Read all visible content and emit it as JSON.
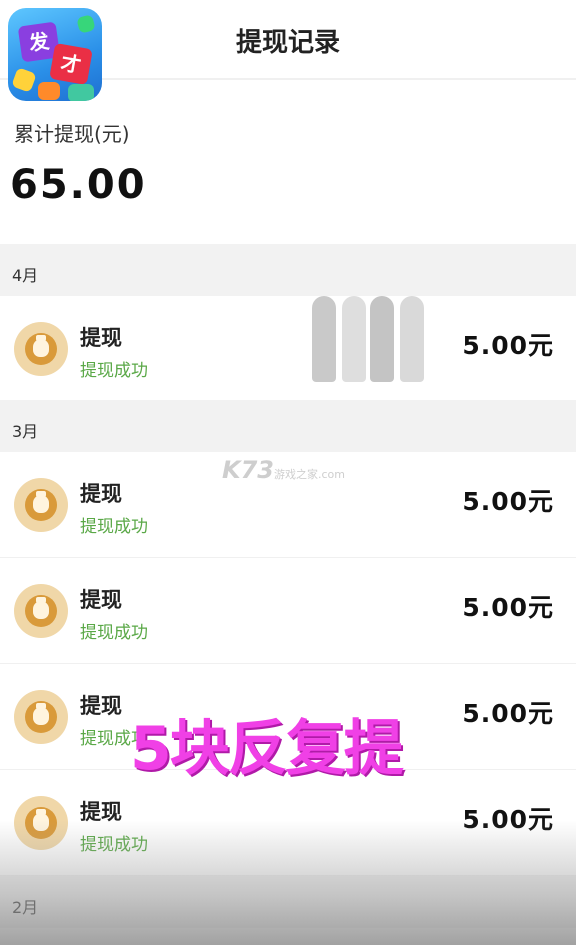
{
  "header": {
    "title": "提现记录",
    "logo": {
      "chars": [
        "发",
        "才"
      ]
    }
  },
  "summary": {
    "label": "累计提现(元)",
    "amount": "65.00"
  },
  "sections": [
    {
      "month": "4月",
      "records": [
        {
          "title": "提现",
          "status": "提现成功",
          "amount": "5.00元"
        }
      ]
    },
    {
      "month": "3月",
      "records": [
        {
          "title": "提现",
          "status": "提现成功",
          "amount": "5.00元"
        },
        {
          "title": "提现",
          "status": "提现成功",
          "amount": "5.00元"
        },
        {
          "title": "提现",
          "status": "提现成功",
          "amount": "5.00元"
        },
        {
          "title": "提现",
          "status": "提现成功",
          "amount": "5.00元"
        }
      ]
    },
    {
      "month": "2月",
      "records": []
    }
  ],
  "overlay": {
    "watermark_main": "K73",
    "watermark_sub": "游戏之家",
    "watermark_domain": ".com",
    "caption": "5块反复提"
  },
  "colors": {
    "status_green": "#5aa847",
    "coin_gold": "#d99a3a",
    "caption_magenta": "#f040e6"
  },
  "icons": {
    "record": "money-bag-icon"
  }
}
